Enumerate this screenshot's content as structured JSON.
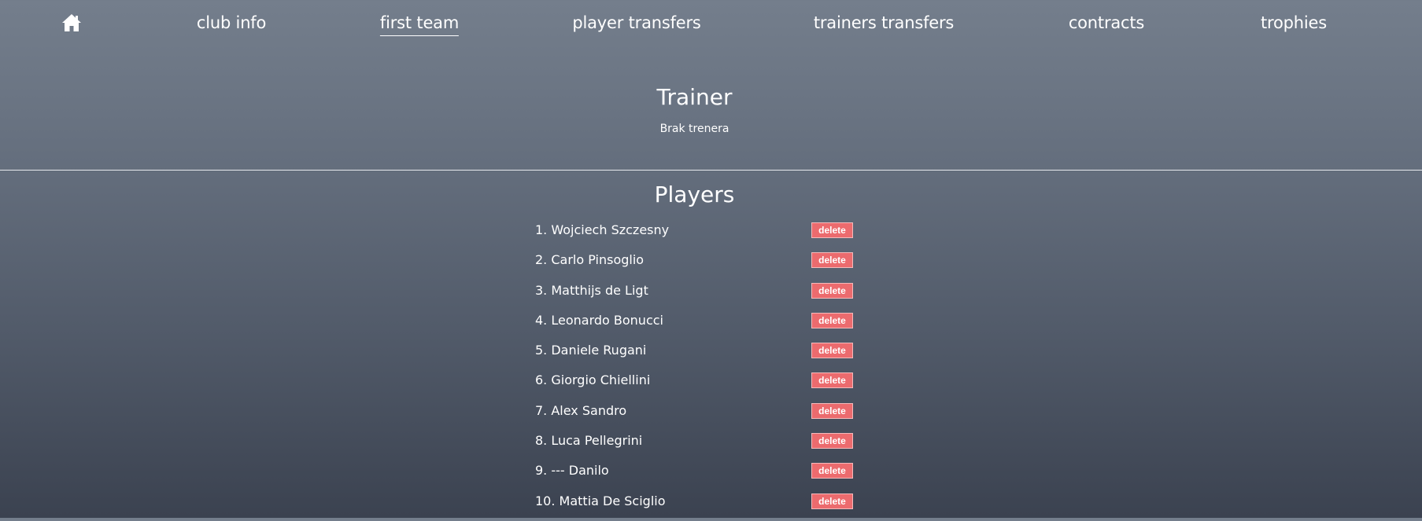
{
  "nav": {
    "home_icon": "home-icon",
    "links": [
      {
        "label": "club info",
        "active": false
      },
      {
        "label": "first team",
        "active": true
      },
      {
        "label": "player transfers",
        "active": false
      },
      {
        "label": "trainers transfers",
        "active": false
      },
      {
        "label": "contracts",
        "active": false
      },
      {
        "label": "trophies",
        "active": false
      }
    ]
  },
  "trainer": {
    "title": "Trainer",
    "value": "Brak trenera"
  },
  "players": {
    "title": "Players",
    "delete_label": "delete",
    "list": [
      {
        "name": "1. Wojciech Szczesny"
      },
      {
        "name": "2. Carlo Pinsoglio"
      },
      {
        "name": "3. Matthijs de Ligt"
      },
      {
        "name": "4. Leonardo Bonucci"
      },
      {
        "name": "5. Daniele Rugani"
      },
      {
        "name": "6. Giorgio Chiellini"
      },
      {
        "name": "7. Alex Sandro"
      },
      {
        "name": "8. Luca Pellegrini"
      },
      {
        "name": "9. --- Danilo"
      },
      {
        "name": "10. Mattia De Sciglio"
      }
    ]
  },
  "colors": {
    "delete_button": "#ec6b6e",
    "text": "#ffffff"
  }
}
